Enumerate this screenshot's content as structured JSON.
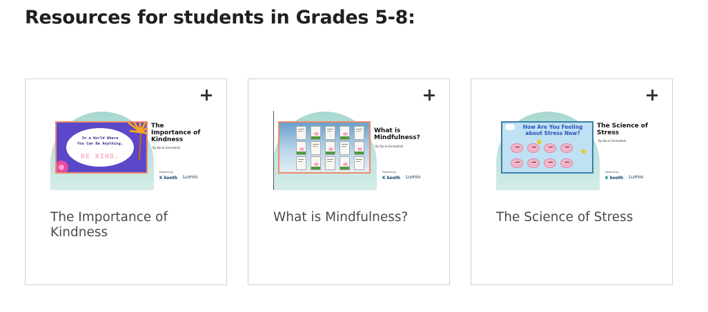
{
  "page": {
    "heading": "Resources for students in Grades 5-8:"
  },
  "cards": [
    {
      "title": "The Importance of Kindness",
      "thumbnail": {
        "slide_title": "The Importance of Kindness",
        "byline": "By Kacie Germadnik",
        "powered_by": "Powered by",
        "logo_kooth": "kooth",
        "logo_lumio": "Lumio",
        "line1": "In a World Where",
        "line2": "You Can Be Anything,",
        "line3": "BE KIND."
      }
    },
    {
      "title": "What is Mindfulness?",
      "thumbnail": {
        "slide_title": "What is Mindfulness?",
        "byline": "By Kacie Germadnik",
        "powered_by": "Powered by",
        "logo_kooth": "kooth",
        "logo_lumio": "Lumio"
      }
    },
    {
      "title": "The Science of Stress",
      "thumbnail": {
        "slide_title": "The Science of Stress",
        "byline": "By Kacie Germadnik",
        "powered_by": "Powered by",
        "logo_kooth": "kooth",
        "logo_lumio": "Lumio",
        "headline": "How Are You Feeling about Stress Now?"
      }
    }
  ],
  "icons": {
    "expand": "plus-icon"
  },
  "colors": {
    "heading": "#1f1f1f",
    "card_title": "#4a4a4a",
    "card_border": "#d0d0d0",
    "wave": "#a7d8d0",
    "slide_border_warm": "#f08a6a",
    "slide_border_cool": "#3a7ea6"
  }
}
